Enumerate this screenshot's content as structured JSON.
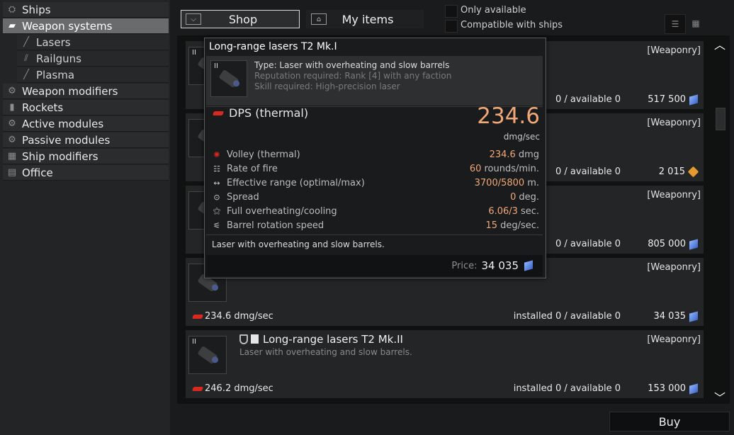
{
  "sidebar": {
    "items": [
      {
        "label": "Ships",
        "icon": "ship-icon"
      },
      {
        "label": "Weapon systems",
        "icon": "weapon-icon"
      },
      {
        "label": "Lasers",
        "icon": "laser-icon"
      },
      {
        "label": "Railguns",
        "icon": "railgun-icon"
      },
      {
        "label": "Plasma",
        "icon": "plasma-icon"
      },
      {
        "label": "Weapon modifiers",
        "icon": "gear-icon"
      },
      {
        "label": "Rockets",
        "icon": "rocket-icon"
      },
      {
        "label": "Active modules",
        "icon": "gear-icon"
      },
      {
        "label": "Passive modules",
        "icon": "gear-icon"
      },
      {
        "label": "Ship modifiers",
        "icon": "grid-icon"
      },
      {
        "label": "Office",
        "icon": "office-icon"
      }
    ]
  },
  "tabs": {
    "shop": "Shop",
    "my_items": "My items"
  },
  "filters": {
    "only_available": "Only available",
    "compatible": "Compatible with ships"
  },
  "items": [
    {
      "tag": "[Weaponry]",
      "installed": "0 / available 0",
      "price": "517 500",
      "currency": "blue"
    },
    {
      "tag": "[Weaponry]",
      "installed": "0 / available 0",
      "price": "2 015",
      "currency": "gold"
    },
    {
      "tag": "[Weaponry]",
      "installed": "0 / available 0",
      "price": "805 000",
      "currency": "blue"
    },
    {
      "tag": "[Weaponry]",
      "dps": "234.6 dmg/sec",
      "installed": "installed 0 / available 0",
      "price": "34 035",
      "currency": "blue"
    },
    {
      "tag": "[Weaponry]",
      "title": "Long-range lasers T2 Mk.II",
      "desc": "Laser with overheating and slow barrels.",
      "dps": "246.2 dmg/sec",
      "installed": "installed 0 / available 0",
      "price": "153 000",
      "currency": "blue"
    }
  ],
  "tooltip": {
    "title": "Long-range lasers T2 Mk.I",
    "type": "Type: Laser with overheating and slow barrels",
    "reputation": "Reputation required: Rank [4] with any faction",
    "skill": "Skill required: High-precision laser",
    "dps_label": "DPS (thermal)",
    "dps_value": "234.6",
    "dps_unit": "dmg/sec",
    "stats": [
      {
        "icon": "volley-icon",
        "label": "Volley (thermal)",
        "value": "234.6",
        "unit": "dmg"
      },
      {
        "icon": "rate-icon",
        "label": "Rate of fire",
        "value": "60",
        "unit": "rounds/min."
      },
      {
        "icon": "range-icon",
        "label": "Effective range (optimal/max)",
        "value": "3700/5800",
        "unit": "m."
      },
      {
        "icon": "spread-icon",
        "label": "Spread",
        "value": "0",
        "unit": "deg."
      },
      {
        "icon": "heat-icon",
        "label": "Full overheating/cooling",
        "value": "6.06/3",
        "unit": "sec."
      },
      {
        "icon": "barrel-icon",
        "label": "Barrel rotation speed",
        "value": "15",
        "unit": "deg/sec."
      }
    ],
    "description": "Laser with overheating and slow barrels.",
    "price_label": "Price:",
    "price_value": "34 035"
  },
  "thumb_tier": "II",
  "buy_label": "Buy",
  "colors": {
    "accent_orange": "#f0a878",
    "dps_red": "#d9281e",
    "active_nav": "#6a6b6d"
  }
}
